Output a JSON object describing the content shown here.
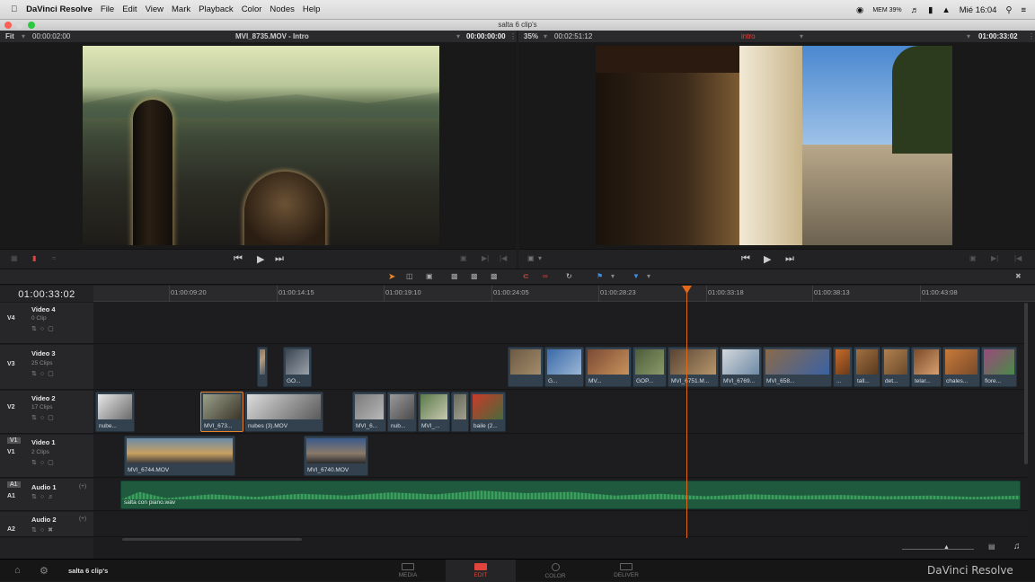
{
  "menubar": {
    "app": "DaVinci Resolve",
    "items": [
      "File",
      "Edit",
      "View",
      "Mark",
      "Playback",
      "Color",
      "Nodes",
      "Help"
    ],
    "mem": "MEM 39%",
    "clock": "Mié 16:04"
  },
  "window": {
    "title": "salta 6 clip's"
  },
  "source_viewer": {
    "zoom": "Fit",
    "duration": "00:00:02:00",
    "clip_name": "MVI_8735.MOV - Intro",
    "timecode": "00:00:00:00"
  },
  "timeline_viewer": {
    "zoom": "35%",
    "duration": "00:02:51:12",
    "timeline_name": "intro",
    "timecode": "01:00:33:02"
  },
  "timeline": {
    "current_timecode": "01:00:33:02",
    "ruler": [
      "01:00:09:20",
      "01:00:14:15",
      "01:00:19:10",
      "01:00:24:05",
      "01:00:28:23",
      "01:00:33:18",
      "01:00:38:13",
      "01:00:43:08"
    ]
  },
  "tracks": {
    "v4": {
      "id": "V4",
      "name": "Video 4",
      "count": "0 Clip"
    },
    "v3": {
      "id": "V3",
      "name": "Video 3",
      "count": "25 Clips"
    },
    "v2": {
      "id": "V2",
      "name": "Video 2",
      "count": "17 Clips"
    },
    "v1": {
      "id": "V1",
      "name": "Video 1",
      "count": "2 Clips",
      "tag": "V1"
    },
    "a1": {
      "id": "A1",
      "name": "Audio 1",
      "ch": "(+)",
      "tag": "A1"
    },
    "a2": {
      "id": "A2",
      "name": "Audio 2",
      "ch": "(+)"
    }
  },
  "clips": {
    "v3": [
      "GO...",
      "G...",
      "MV...",
      "GOP...",
      "MVI_6751.M...",
      "MVI_6769...",
      "MVI_658...",
      "...",
      "tall...",
      "det...",
      "telar...",
      "chales...",
      "flore..."
    ],
    "v2": [
      "nube...",
      "MVI_673...",
      "nubes (3).MOV",
      "MVI_6...",
      "nub...",
      "MVI_...",
      "baile (2..."
    ],
    "v1": [
      "MVI_6744.MOV",
      "MVI_6740.MOV"
    ],
    "a1": "salta con piano.wav"
  },
  "bottom": {
    "project": "salta 6 clip's",
    "pages": [
      "MEDIA",
      "EDIT",
      "COLOR",
      "DELIVER"
    ],
    "brand": "DaVinci Resolve"
  },
  "colors": {
    "accent": "#e0443c",
    "playhead": "#e06a1a",
    "audio": "#1f5a3e"
  }
}
